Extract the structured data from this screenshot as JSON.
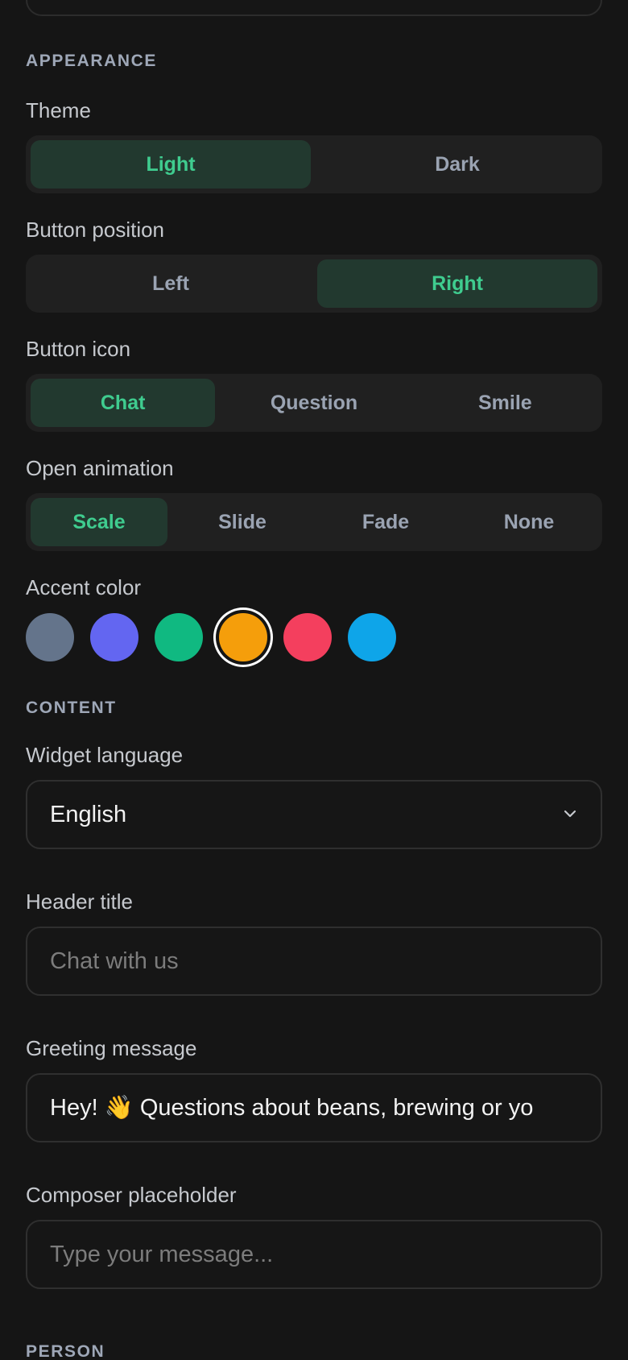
{
  "sections": {
    "appearance": "APPEARANCE",
    "content": "CONTENT",
    "person": "PERSON"
  },
  "theme": {
    "label": "Theme",
    "options": [
      "Light",
      "Dark"
    ],
    "selected": "Light"
  },
  "button_position": {
    "label": "Button position",
    "options": [
      "Left",
      "Right"
    ],
    "selected": "Right"
  },
  "button_icon": {
    "label": "Button icon",
    "options": [
      "Chat",
      "Question",
      "Smile"
    ],
    "selected": "Chat"
  },
  "open_animation": {
    "label": "Open animation",
    "options": [
      "Scale",
      "Slide",
      "Fade",
      "None"
    ],
    "selected": "Scale"
  },
  "accent_color": {
    "label": "Accent color",
    "colors": [
      "#64748b",
      "#6366f1",
      "#10b981",
      "#f59e0b",
      "#f43f5e",
      "#0ea5e9"
    ],
    "selected": "#f59e0b"
  },
  "widget_language": {
    "label": "Widget language",
    "value": "English"
  },
  "header_title": {
    "label": "Header title",
    "placeholder": "Chat with us"
  },
  "greeting_message": {
    "label": "Greeting message",
    "value": "Hey! 👋 Questions about beans, brewing or yo"
  },
  "composer_placeholder": {
    "label": "Composer placeholder",
    "placeholder": "Type your message..."
  },
  "accent_active_bg": "#22392f",
  "accent_active_text": "#3fcc8f"
}
